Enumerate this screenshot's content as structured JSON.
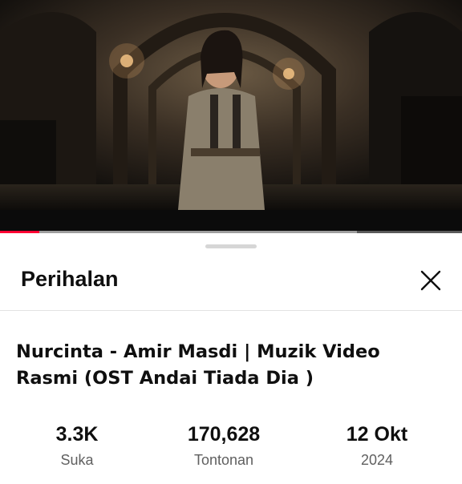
{
  "player": {
    "progress_played_fraction": 0.085,
    "progress_buffered_fraction": 0.773,
    "accent_color": "#ff0033"
  },
  "sheet": {
    "title": "Perihalan",
    "close_icon": "close-icon"
  },
  "video": {
    "title": "Nurcinta - Amir Masdi | Muzik Video Rasmi (OST Andai Tiada Dia )"
  },
  "stats": {
    "likes_value": "3.3K",
    "likes_label": "Suka",
    "views_value": "170,628",
    "views_label": "Tontonan",
    "date_value": "12 Okt",
    "date_label": "2024"
  }
}
